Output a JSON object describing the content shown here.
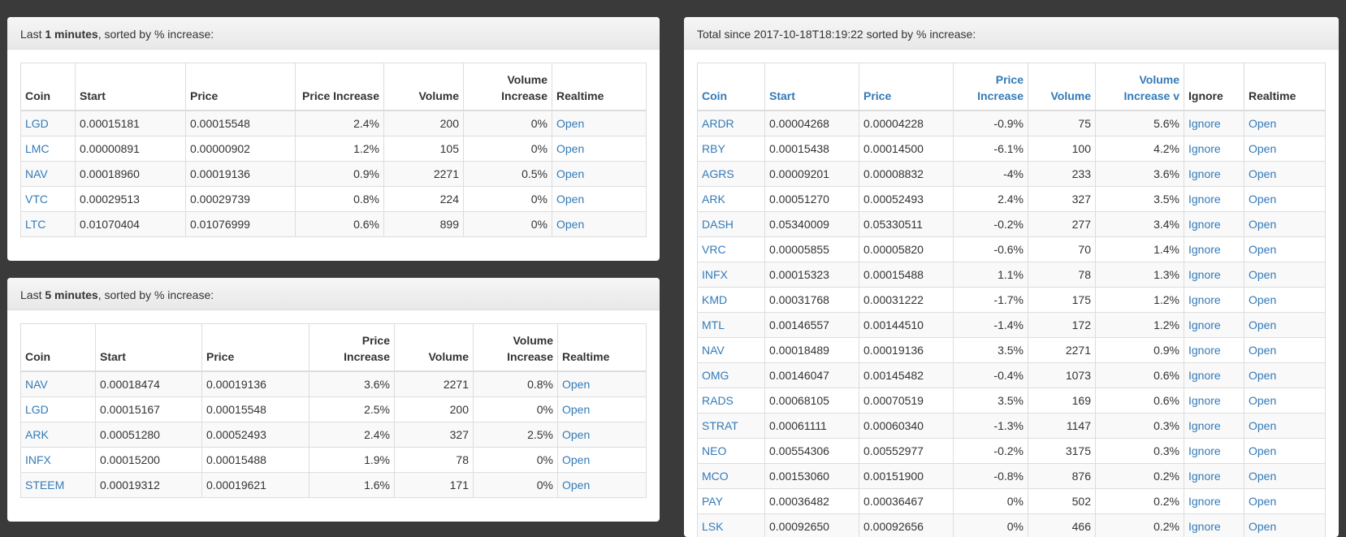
{
  "panel1": {
    "heading_pre": "Last ",
    "heading_bold": "1 minutes",
    "heading_post": ", sorted by % increase:",
    "headers": {
      "coin": "Coin",
      "start": "Start",
      "price": "Price",
      "price_increase": "Price Increase",
      "volume": "Volume",
      "volume_increase": "Volume Increase",
      "realtime": "Realtime"
    },
    "rows": [
      {
        "coin": "LGD",
        "start": "0.00015181",
        "price": "0.00015548",
        "pinc": "2.4%",
        "vol": "200",
        "vinc": "0%",
        "rt": "Open"
      },
      {
        "coin": "LMC",
        "start": "0.00000891",
        "price": "0.00000902",
        "pinc": "1.2%",
        "vol": "105",
        "vinc": "0%",
        "rt": "Open"
      },
      {
        "coin": "NAV",
        "start": "0.00018960",
        "price": "0.00019136",
        "pinc": "0.9%",
        "vol": "2271",
        "vinc": "0.5%",
        "rt": "Open"
      },
      {
        "coin": "VTC",
        "start": "0.00029513",
        "price": "0.00029739",
        "pinc": "0.8%",
        "vol": "224",
        "vinc": "0%",
        "rt": "Open"
      },
      {
        "coin": "LTC",
        "start": "0.01070404",
        "price": "0.01076999",
        "pinc": "0.6%",
        "vol": "899",
        "vinc": "0%",
        "rt": "Open"
      }
    ]
  },
  "panel2": {
    "heading_pre": "Last ",
    "heading_bold": "5 minutes",
    "heading_post": ", sorted by % increase:",
    "headers": {
      "coin": "Coin",
      "start": "Start",
      "price": "Price",
      "price_increase": "Price Increase",
      "volume": "Volume",
      "volume_increase": "Volume Increase",
      "realtime": "Realtime"
    },
    "rows": [
      {
        "coin": "NAV",
        "start": "0.00018474",
        "price": "0.00019136",
        "pinc": "3.6%",
        "vol": "2271",
        "vinc": "0.8%",
        "rt": "Open"
      },
      {
        "coin": "LGD",
        "start": "0.00015167",
        "price": "0.00015548",
        "pinc": "2.5%",
        "vol": "200",
        "vinc": "0%",
        "rt": "Open"
      },
      {
        "coin": "ARK",
        "start": "0.00051280",
        "price": "0.00052493",
        "pinc": "2.4%",
        "vol": "327",
        "vinc": "2.5%",
        "rt": "Open"
      },
      {
        "coin": "INFX",
        "start": "0.00015200",
        "price": "0.00015488",
        "pinc": "1.9%",
        "vol": "78",
        "vinc": "0%",
        "rt": "Open"
      },
      {
        "coin": "STEEM",
        "start": "0.00019312",
        "price": "0.00019621",
        "pinc": "1.6%",
        "vol": "171",
        "vinc": "0%",
        "rt": "Open"
      }
    ]
  },
  "panel3": {
    "heading": "Total since 2017-10-18T18:19:22 sorted by % increase:",
    "headers": {
      "coin": "Coin",
      "start": "Start",
      "price": "Price",
      "price_increase": "Price Increase",
      "volume": "Volume",
      "volume_increase": "Volume Increase v",
      "ignore": "Ignore",
      "realtime": "Realtime"
    },
    "rows": [
      {
        "coin": "ARDR",
        "start": "0.00004268",
        "price": "0.00004228",
        "pinc": "-0.9%",
        "vol": "75",
        "vinc": "5.6%",
        "ign": "Ignore",
        "rt": "Open"
      },
      {
        "coin": "RBY",
        "start": "0.00015438",
        "price": "0.00014500",
        "pinc": "-6.1%",
        "vol": "100",
        "vinc": "4.2%",
        "ign": "Ignore",
        "rt": "Open"
      },
      {
        "coin": "AGRS",
        "start": "0.00009201",
        "price": "0.00008832",
        "pinc": "-4%",
        "vol": "233",
        "vinc": "3.6%",
        "ign": "Ignore",
        "rt": "Open"
      },
      {
        "coin": "ARK",
        "start": "0.00051270",
        "price": "0.00052493",
        "pinc": "2.4%",
        "vol": "327",
        "vinc": "3.5%",
        "ign": "Ignore",
        "rt": "Open"
      },
      {
        "coin": "DASH",
        "start": "0.05340009",
        "price": "0.05330511",
        "pinc": "-0.2%",
        "vol": "277",
        "vinc": "3.4%",
        "ign": "Ignore",
        "rt": "Open"
      },
      {
        "coin": "VRC",
        "start": "0.00005855",
        "price": "0.00005820",
        "pinc": "-0.6%",
        "vol": "70",
        "vinc": "1.4%",
        "ign": "Ignore",
        "rt": "Open"
      },
      {
        "coin": "INFX",
        "start": "0.00015323",
        "price": "0.00015488",
        "pinc": "1.1%",
        "vol": "78",
        "vinc": "1.3%",
        "ign": "Ignore",
        "rt": "Open"
      },
      {
        "coin": "KMD",
        "start": "0.00031768",
        "price": "0.00031222",
        "pinc": "-1.7%",
        "vol": "175",
        "vinc": "1.2%",
        "ign": "Ignore",
        "rt": "Open"
      },
      {
        "coin": "MTL",
        "start": "0.00146557",
        "price": "0.00144510",
        "pinc": "-1.4%",
        "vol": "172",
        "vinc": "1.2%",
        "ign": "Ignore",
        "rt": "Open"
      },
      {
        "coin": "NAV",
        "start": "0.00018489",
        "price": "0.00019136",
        "pinc": "3.5%",
        "vol": "2271",
        "vinc": "0.9%",
        "ign": "Ignore",
        "rt": "Open"
      },
      {
        "coin": "OMG",
        "start": "0.00146047",
        "price": "0.00145482",
        "pinc": "-0.4%",
        "vol": "1073",
        "vinc": "0.6%",
        "ign": "Ignore",
        "rt": "Open"
      },
      {
        "coin": "RADS",
        "start": "0.00068105",
        "price": "0.00070519",
        "pinc": "3.5%",
        "vol": "169",
        "vinc": "0.6%",
        "ign": "Ignore",
        "rt": "Open"
      },
      {
        "coin": "STRAT",
        "start": "0.00061111",
        "price": "0.00060340",
        "pinc": "-1.3%",
        "vol": "1147",
        "vinc": "0.3%",
        "ign": "Ignore",
        "rt": "Open"
      },
      {
        "coin": "NEO",
        "start": "0.00554306",
        "price": "0.00552977",
        "pinc": "-0.2%",
        "vol": "3175",
        "vinc": "0.3%",
        "ign": "Ignore",
        "rt": "Open"
      },
      {
        "coin": "MCO",
        "start": "0.00153060",
        "price": "0.00151900",
        "pinc": "-0.8%",
        "vol": "876",
        "vinc": "0.2%",
        "ign": "Ignore",
        "rt": "Open"
      },
      {
        "coin": "PAY",
        "start": "0.00036482",
        "price": "0.00036467",
        "pinc": "0%",
        "vol": "502",
        "vinc": "0.2%",
        "ign": "Ignore",
        "rt": "Open"
      },
      {
        "coin": "LSK",
        "start": "0.00092650",
        "price": "0.00092656",
        "pinc": "0%",
        "vol": "466",
        "vinc": "0.2%",
        "ign": "Ignore",
        "rt": "Open"
      }
    ]
  }
}
